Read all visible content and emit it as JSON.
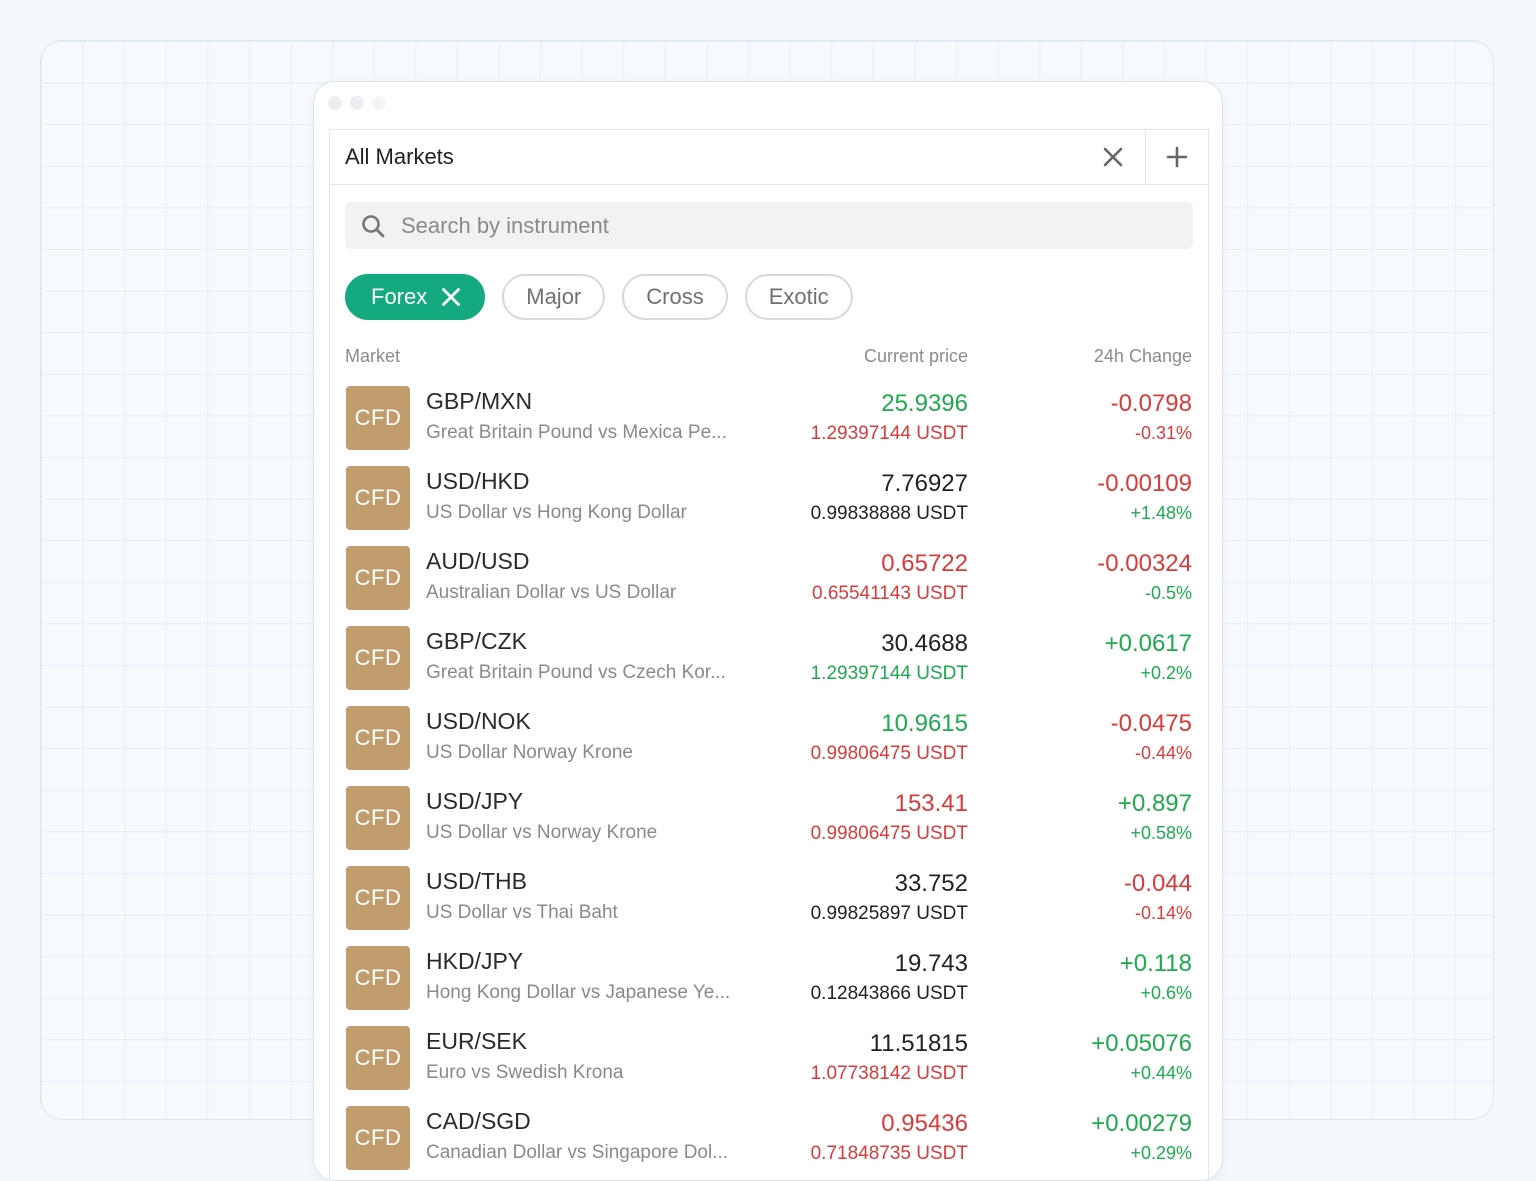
{
  "panel": {
    "title": "All Markets",
    "search_placeholder": "Search by instrument",
    "filters": [
      {
        "label": "Forex",
        "active": true
      },
      {
        "label": "Major",
        "active": false
      },
      {
        "label": "Cross",
        "active": false
      },
      {
        "label": "Exotic",
        "active": false
      }
    ],
    "columns": {
      "market": "Market",
      "price": "Current price",
      "change": "24h Change"
    }
  },
  "colors": {
    "accent": "#14a97e",
    "up": "#1ea94f",
    "down": "#d83a3a",
    "badge": "#c19c6d"
  },
  "markets": [
    {
      "badge": "CFD",
      "symbol": "GBP/MXN",
      "name": "Great Britain Pound vs Mexica Pe...",
      "price": "25.9396",
      "price_dir": "up",
      "usdt": "1.29397144 USDT",
      "usdt_dir": "down",
      "change": "-0.0798",
      "change_dir": "down",
      "pct": "-0.31%",
      "pct_dir": "down"
    },
    {
      "badge": "CFD",
      "symbol": "USD/HKD",
      "name": "US Dollar vs Hong Kong Dollar",
      "price": "7.76927",
      "price_dir": "neutral",
      "usdt": "0.99838888 USDT",
      "usdt_dir": "neutral",
      "change": "-0.00109",
      "change_dir": "down",
      "pct": "+1.48%",
      "pct_dir": "up"
    },
    {
      "badge": "CFD",
      "symbol": "AUD/USD",
      "name": "Australian Dollar vs US Dollar",
      "price": "0.65722",
      "price_dir": "down",
      "usdt": "0.65541143 USDT",
      "usdt_dir": "down",
      "change": "-0.00324",
      "change_dir": "down",
      "pct": "-0.5%",
      "pct_dir": "up"
    },
    {
      "badge": "CFD",
      "symbol": "GBP/CZK",
      "name": "Great Britain Pound vs Czech Kor...",
      "price": "30.4688",
      "price_dir": "neutral",
      "usdt": "1.29397144 USDT",
      "usdt_dir": "up",
      "change": "+0.0617",
      "change_dir": "up",
      "pct": "+0.2%",
      "pct_dir": "up"
    },
    {
      "badge": "CFD",
      "symbol": "USD/NOK",
      "name": "US Dollar Norway Krone",
      "price": "10.9615",
      "price_dir": "up",
      "usdt": "0.99806475 USDT",
      "usdt_dir": "down",
      "change": "-0.0475",
      "change_dir": "down",
      "pct": "-0.44%",
      "pct_dir": "down"
    },
    {
      "badge": "CFD",
      "symbol": "USD/JPY",
      "name": "US Dollar vs Norway Krone",
      "price": "153.41",
      "price_dir": "down",
      "usdt": "0.99806475 USDT",
      "usdt_dir": "down",
      "change": "+0.897",
      "change_dir": "up",
      "pct": "+0.58%",
      "pct_dir": "up"
    },
    {
      "badge": "CFD",
      "symbol": "USD/THB",
      "name": "US Dollar vs Thai Baht",
      "price": "33.752",
      "price_dir": "neutral",
      "usdt": "0.99825897 USDT",
      "usdt_dir": "neutral",
      "change": "-0.044",
      "change_dir": "down",
      "pct": "-0.14%",
      "pct_dir": "down"
    },
    {
      "badge": "CFD",
      "symbol": "HKD/JPY",
      "name": "Hong Kong Dollar vs Japanese Ye...",
      "price": "19.743",
      "price_dir": "neutral",
      "usdt": "0.12843866 USDT",
      "usdt_dir": "neutral",
      "change": "+0.118",
      "change_dir": "up",
      "pct": "+0.6%",
      "pct_dir": "up"
    },
    {
      "badge": "CFD",
      "symbol": "EUR/SEK",
      "name": "Euro vs Swedish Krona",
      "price": "11.51815",
      "price_dir": "neutral",
      "usdt": "1.07738142 USDT",
      "usdt_dir": "down",
      "change": "+0.05076",
      "change_dir": "up",
      "pct": "+0.44%",
      "pct_dir": "up"
    },
    {
      "badge": "CFD",
      "symbol": "CAD/SGD",
      "name": "Canadian Dollar vs Singapore Dol...",
      "price": "0.95436",
      "price_dir": "down",
      "usdt": "0.71848735 USDT",
      "usdt_dir": "down",
      "change": "+0.00279",
      "change_dir": "up",
      "pct": "+0.29%",
      "pct_dir": "up"
    }
  ]
}
